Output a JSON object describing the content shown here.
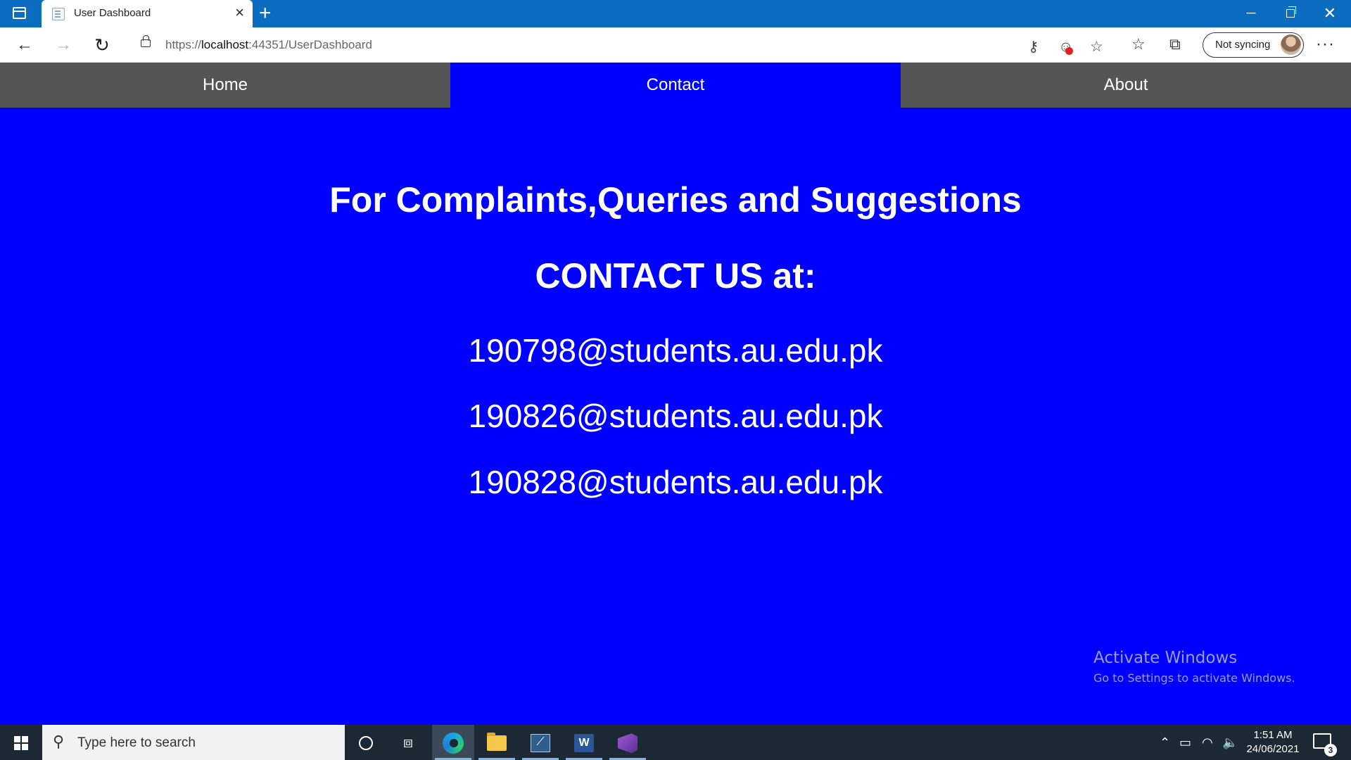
{
  "browser": {
    "tab_title": "User Dashboard",
    "tab_close": "×",
    "new_tab": "+",
    "url_prefix": "https://",
    "url_host": "localhost",
    "url_rest": ":44351/UserDashboard",
    "sync_label": "Not syncing",
    "more": "···",
    "icons": {
      "back": "back-arrow-icon",
      "forward": "forward-arrow-icon",
      "reload": "reload-icon",
      "lock": "lock-icon",
      "key": "key-icon",
      "tracker": "tracking-prevention-icon",
      "add_favorite": "add-favorite-icon",
      "favorites": "favorites-icon",
      "collections": "collections-icon"
    }
  },
  "nav": {
    "items": [
      {
        "label": "Home",
        "active": false
      },
      {
        "label": "Contact",
        "active": true
      },
      {
        "label": "About",
        "active": false
      }
    ]
  },
  "content": {
    "heading": "For Complaints,Queries and Suggestions",
    "subheading": "CONTACT US at:",
    "emails": [
      "190798@students.au.edu.pk",
      "190826@students.au.edu.pk",
      "190828@students.au.edu.pk"
    ]
  },
  "watermark": {
    "title": "Activate Windows",
    "subtitle": "Go to Settings to activate Windows."
  },
  "taskbar": {
    "search_placeholder": "Type here to search",
    "time": "1:51 AM",
    "date": "24/06/2021",
    "notification_count": "3",
    "word_letter": "W"
  },
  "colors": {
    "page_background": "#0000ff",
    "menu_background": "#555555",
    "menu_active": "#0000ff",
    "titlebar": "#0b6cc0",
    "taskbar": "#1c2833"
  }
}
